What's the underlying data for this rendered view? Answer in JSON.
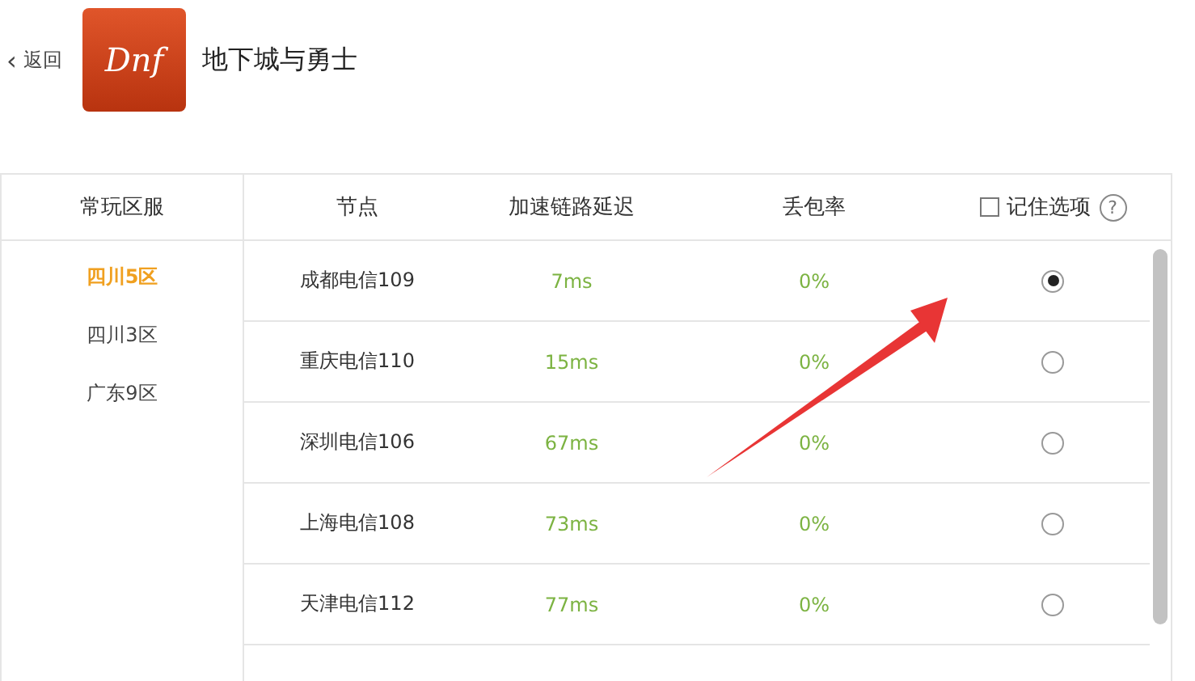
{
  "header": {
    "back": {
      "icon": "‹",
      "label": "返回"
    },
    "logo_text": "Dnf",
    "game_title": "地下城与勇士"
  },
  "table": {
    "region_heading": "常玩区服",
    "columns": [
      "节点",
      "加速链路延迟",
      "丢包率"
    ],
    "remember": {
      "label": "记住选项",
      "checked": false,
      "help": "?"
    },
    "regions": [
      {
        "label": "四川5区",
        "selected": true
      },
      {
        "label": "四川3区",
        "selected": false
      },
      {
        "label": "广东9区",
        "selected": false
      }
    ],
    "rows": [
      {
        "node": "成都电信109",
        "latency": "7ms",
        "loss": "0%",
        "selected": true
      },
      {
        "node": "重庆电信110",
        "latency": "15ms",
        "loss": "0%",
        "selected": false
      },
      {
        "node": "深圳电信106",
        "latency": "67ms",
        "loss": "0%",
        "selected": false
      },
      {
        "node": "上海电信108",
        "latency": "73ms",
        "loss": "0%",
        "selected": false
      },
      {
        "node": "天津电信112",
        "latency": "77ms",
        "loss": "0%",
        "selected": false
      }
    ]
  },
  "annotation": {
    "kind": "arrow"
  }
}
